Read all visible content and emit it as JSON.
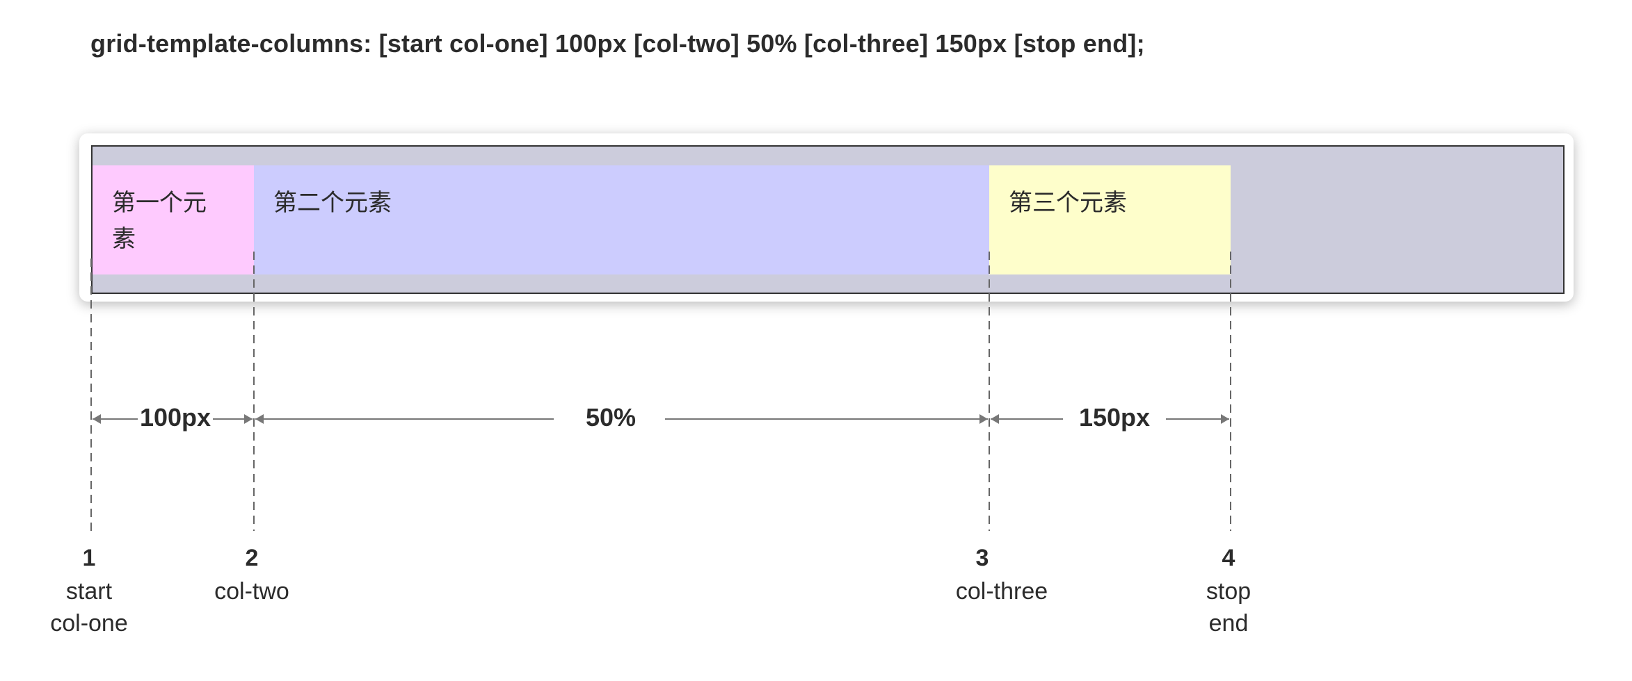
{
  "code": "grid-template-columns: [start col-one] 100px [col-two] 50% [col-three] 150px [stop end];",
  "cells": [
    {
      "text": "第一个元素",
      "color": "#fecafe"
    },
    {
      "text": "第二个元素",
      "color": "#ccccfe"
    },
    {
      "text": "第三个元素",
      "color": "#fefecb"
    }
  ],
  "track_sizes": [
    "100px",
    "50%",
    "150px"
  ],
  "lines": [
    {
      "number": "1",
      "names": [
        "start",
        "col-one"
      ]
    },
    {
      "number": "2",
      "names": [
        "col-two"
      ]
    },
    {
      "number": "3",
      "names": [
        "col-three"
      ]
    },
    {
      "number": "4",
      "names": [
        "stop",
        "end"
      ]
    }
  ],
  "colors": {
    "container_bg": "#ccccdc",
    "border": "#333333",
    "guide": "#777777"
  }
}
